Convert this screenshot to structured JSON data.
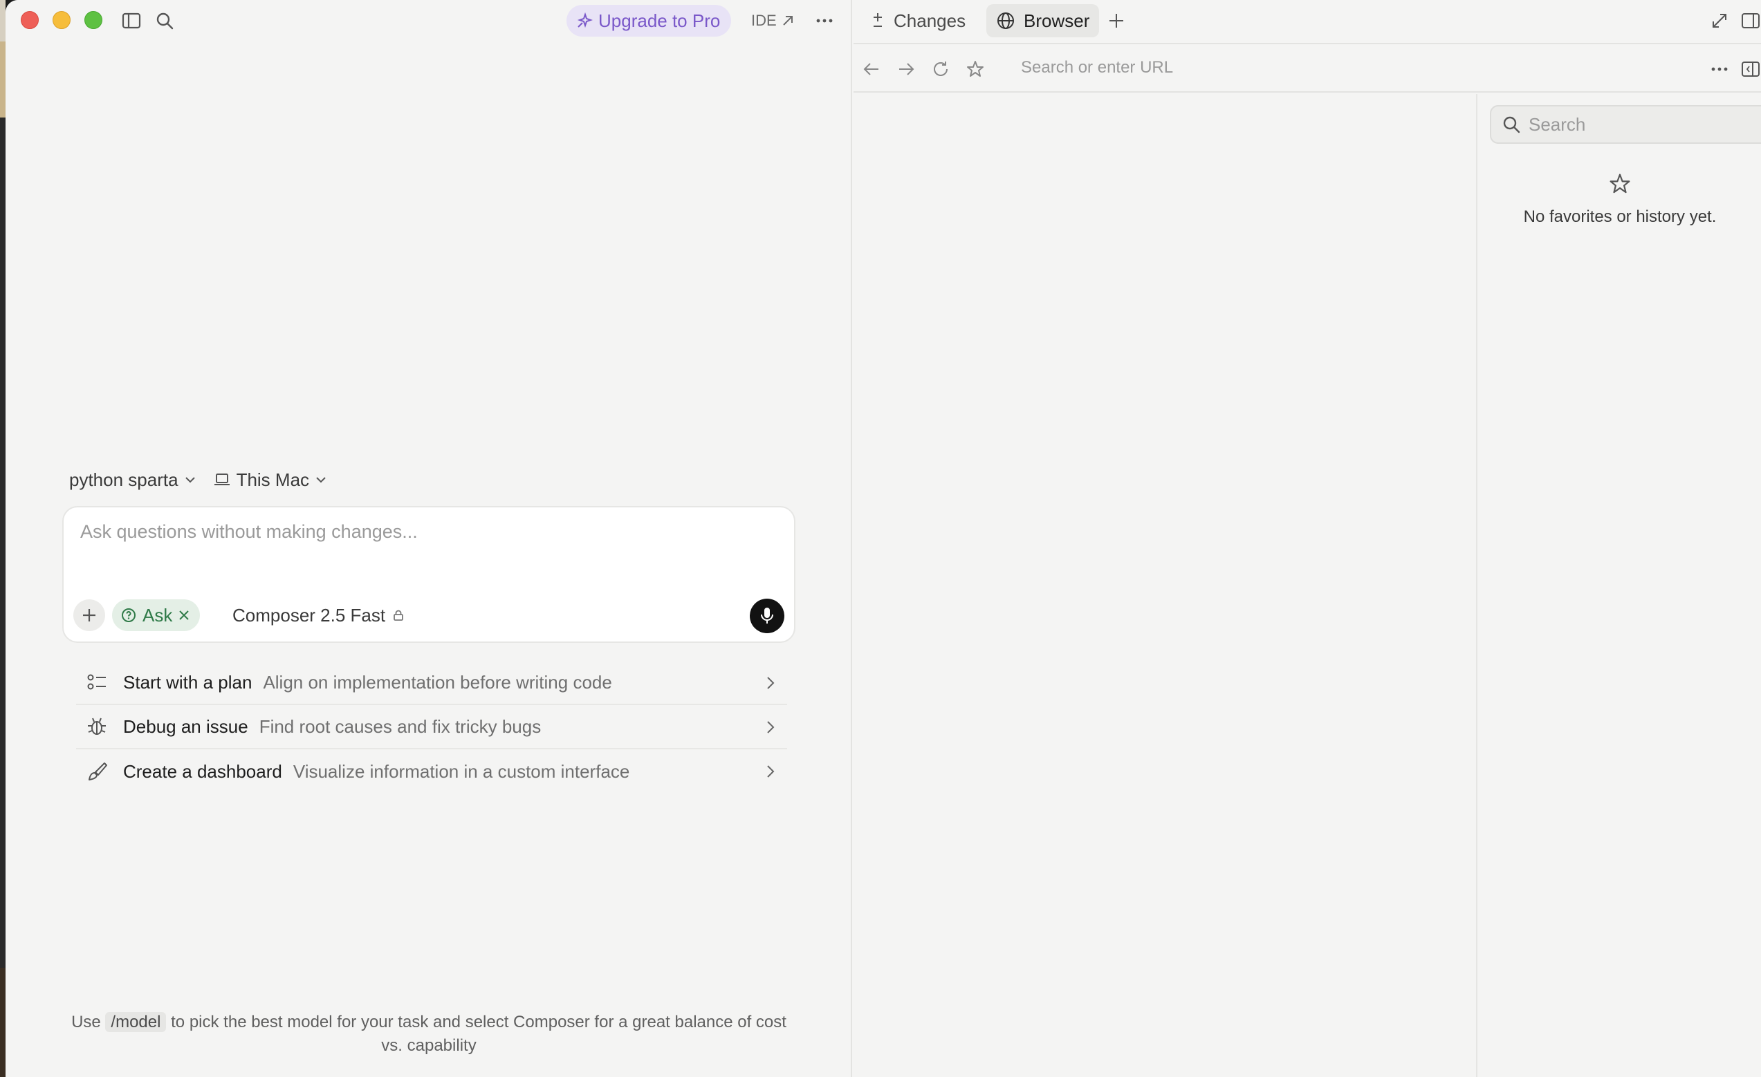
{
  "titlebar": {
    "upgrade_label": "Upgrade to Pro",
    "ide_label": "IDE"
  },
  "context": {
    "project": "python sparta",
    "machine": "This Mac"
  },
  "composer": {
    "placeholder": "Ask questions without making changes...",
    "mode_label": "Ask",
    "model_label": "Composer 2.5 Fast"
  },
  "suggestions": [
    {
      "title": "Start with a plan",
      "desc": "Align on implementation before writing code",
      "icon": "plan-list-icon"
    },
    {
      "title": "Debug an issue",
      "desc": "Find root causes and fix tricky bugs",
      "icon": "bug-icon"
    },
    {
      "title": "Create a dashboard",
      "desc": "Visualize information in a custom interface",
      "icon": "brush-icon"
    }
  ],
  "footer": {
    "pre": "Use",
    "command": "/model",
    "post": "to pick the best model for your task and select Composer for a great balance of cost vs. capability"
  },
  "right": {
    "tabs": [
      {
        "label": "Changes",
        "icon": "plus-minus-icon"
      },
      {
        "label": "Browser",
        "icon": "globe-icon"
      }
    ],
    "url_placeholder": "Search or enter URL",
    "search_placeholder": "Search",
    "empty_text": "No favorites or history yet."
  },
  "colors": {
    "accent_purple": "#7a58c9",
    "ask_green": "#2f7a48",
    "background": "#f4f4f3"
  }
}
